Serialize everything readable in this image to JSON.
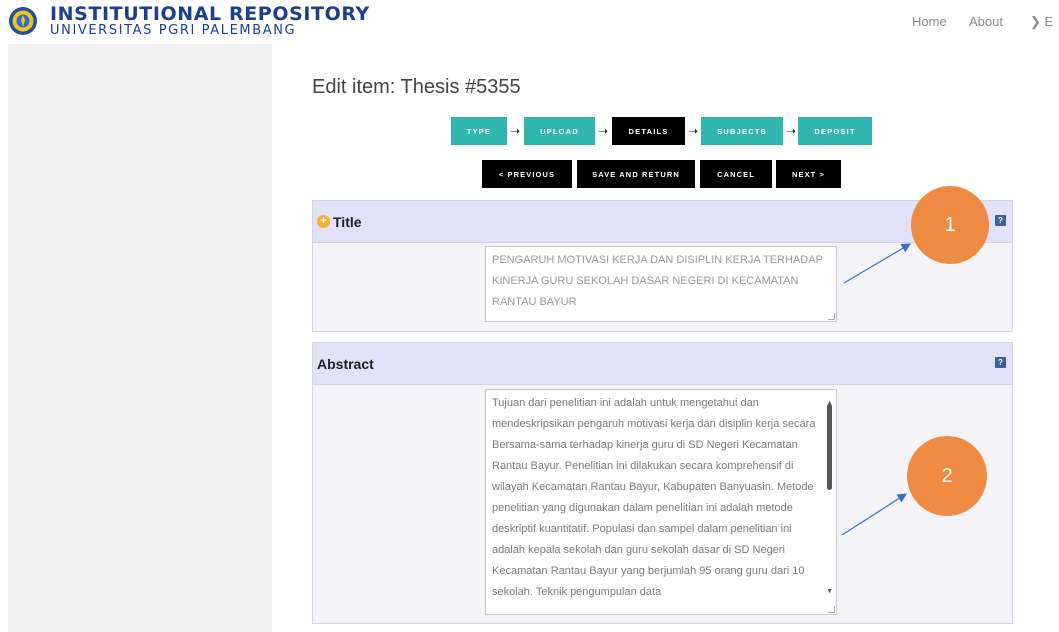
{
  "header": {
    "brand_title": "INSTITUTIONAL REPOSITORY",
    "brand_subtitle": "UNIVERSITAS PGRI PALEMBANG",
    "nav": [
      {
        "label": "Home"
      },
      {
        "label": "About"
      },
      {
        "label": "❯ E"
      }
    ]
  },
  "page_title": "Edit item: Thesis #5355",
  "workflow": {
    "steps": [
      "TYPE",
      "UPLOAD",
      "DETAILS",
      "SUBJECTS",
      "DEPOSIT"
    ],
    "active_step": "DETAILS"
  },
  "actions": {
    "previous": "< PREVIOUS",
    "save_return": "SAVE AND RETURN",
    "cancel": "CANCEL",
    "next": "NEXT >"
  },
  "title_field": {
    "label": "Title",
    "help": "?",
    "value": "PENGARUH MOTIVASI KERJA DAN DISIPLIN KERJA TERHADAP KINERJA GURU SEKOLAH DASAR NEGERI DI KECAMATAN RANTAU BAYUR"
  },
  "abstract_field": {
    "label": "Abstract",
    "help": "?",
    "value": "Tujuan dari penelitian ini adalah untuk mengetahui dan mendeskripsikan pengaruh motivasi kerja dan disiplin kerja secara Bersama-sama terhadap kinerja guru di SD Negeri Kecamatan Rantau Bayur. Penelitian ini dilakukan secara komprehensif di wilayah Kecamatan Rantau Bayur, Kabupaten Banyuasin. Metode penelitian yang digunakan dalam penelitian ini adalah metode deskriptif kuantitatif. Populasi dan sampel dalam penelitian ini adalah kepala sekolah dan guru sekolah dasar di SD Negeri Kecamatan Rantau Bayur yang berjumlah 95 orang guru dari 10 sekolah. Teknik pengumpulan data"
  },
  "callouts": [
    "1",
    "2"
  ],
  "colors": {
    "brand": "#1b3f8f",
    "step": "#31b5b0",
    "step_active": "#000000",
    "panel_header": "#e1e1f7",
    "callout": "#ef8a43",
    "arrow": "#3a6fc9"
  }
}
